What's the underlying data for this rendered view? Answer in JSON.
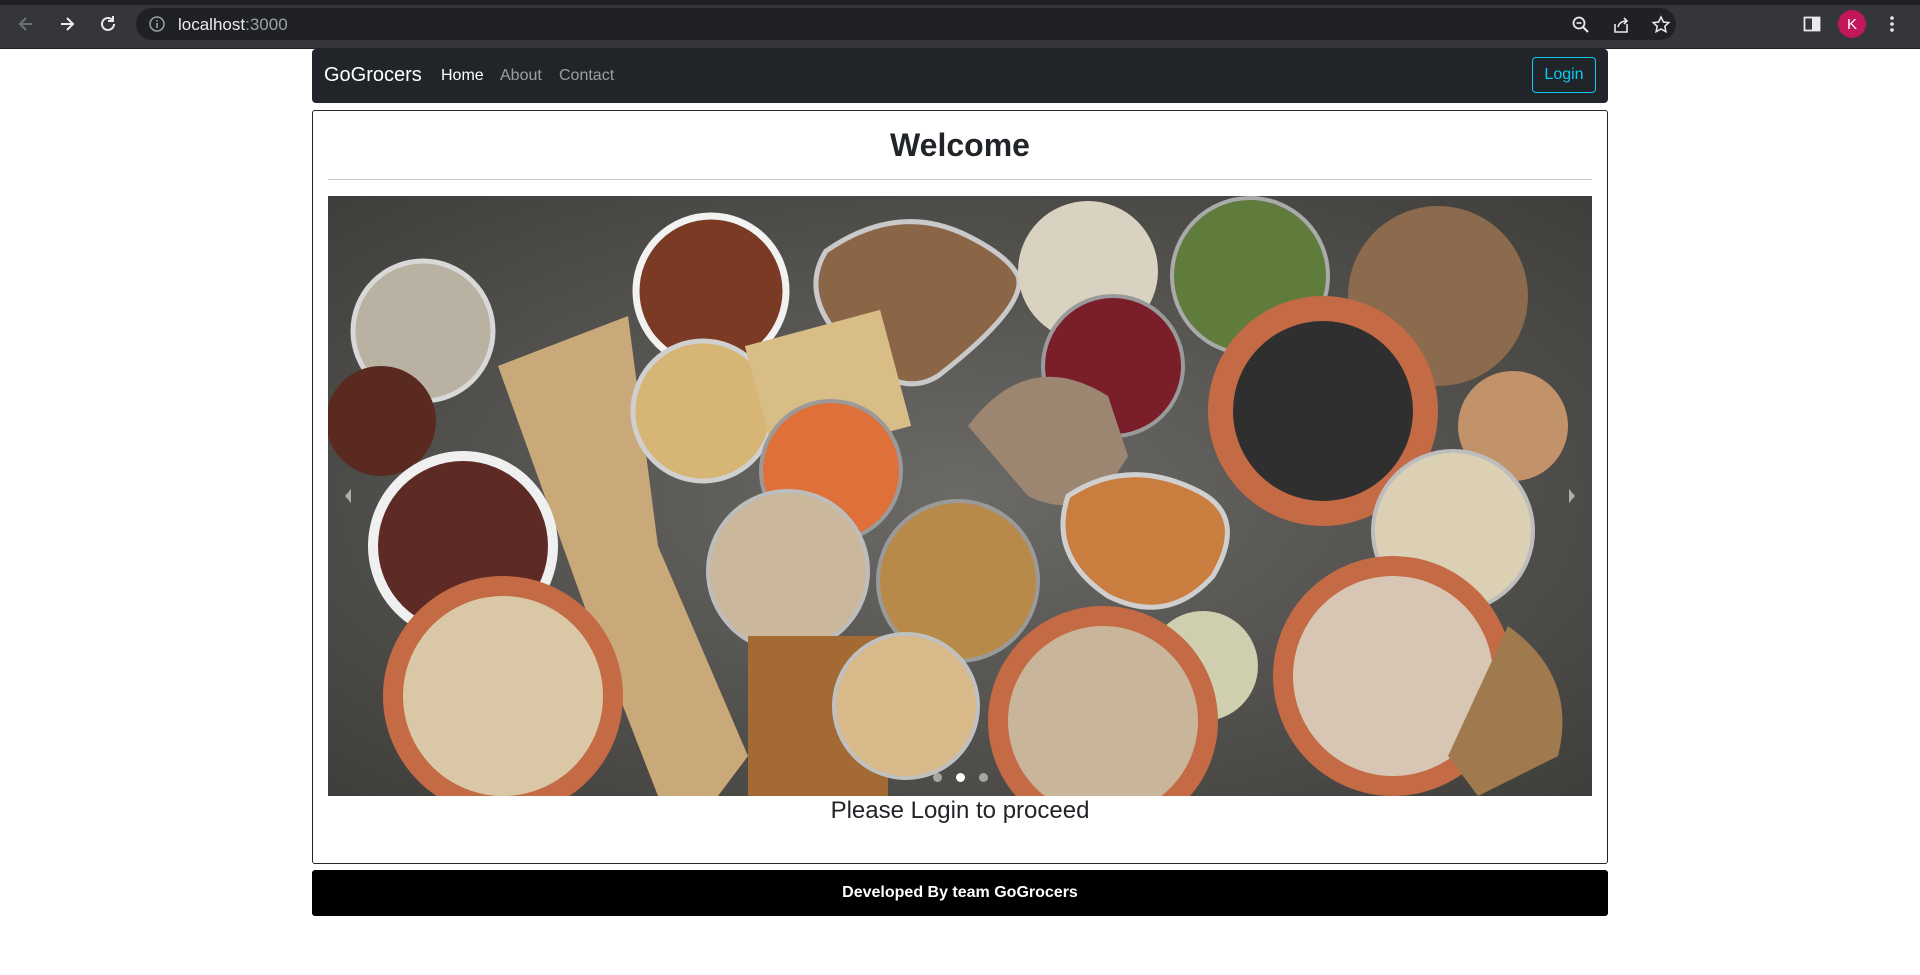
{
  "browser": {
    "url_host": "localhost",
    "url_port": ":3000",
    "profile_initial": "K"
  },
  "navbar": {
    "brand": "GoGrocers",
    "links": [
      {
        "label": "Home",
        "active": true
      },
      {
        "label": "About",
        "active": false
      },
      {
        "label": "Contact",
        "active": false
      }
    ],
    "login_label": "Login"
  },
  "main": {
    "title": "Welcome",
    "carousel": {
      "slide_count": 3,
      "active_index": 1
    },
    "message": "Please Login to proceed"
  },
  "footer": {
    "text": "Developed By team GoGrocers"
  },
  "colors": {
    "navbar_bg": "#212529",
    "login_accent": "#0dcaf0",
    "footer_bg": "#000000",
    "avatar_bg": "#c2185b"
  }
}
